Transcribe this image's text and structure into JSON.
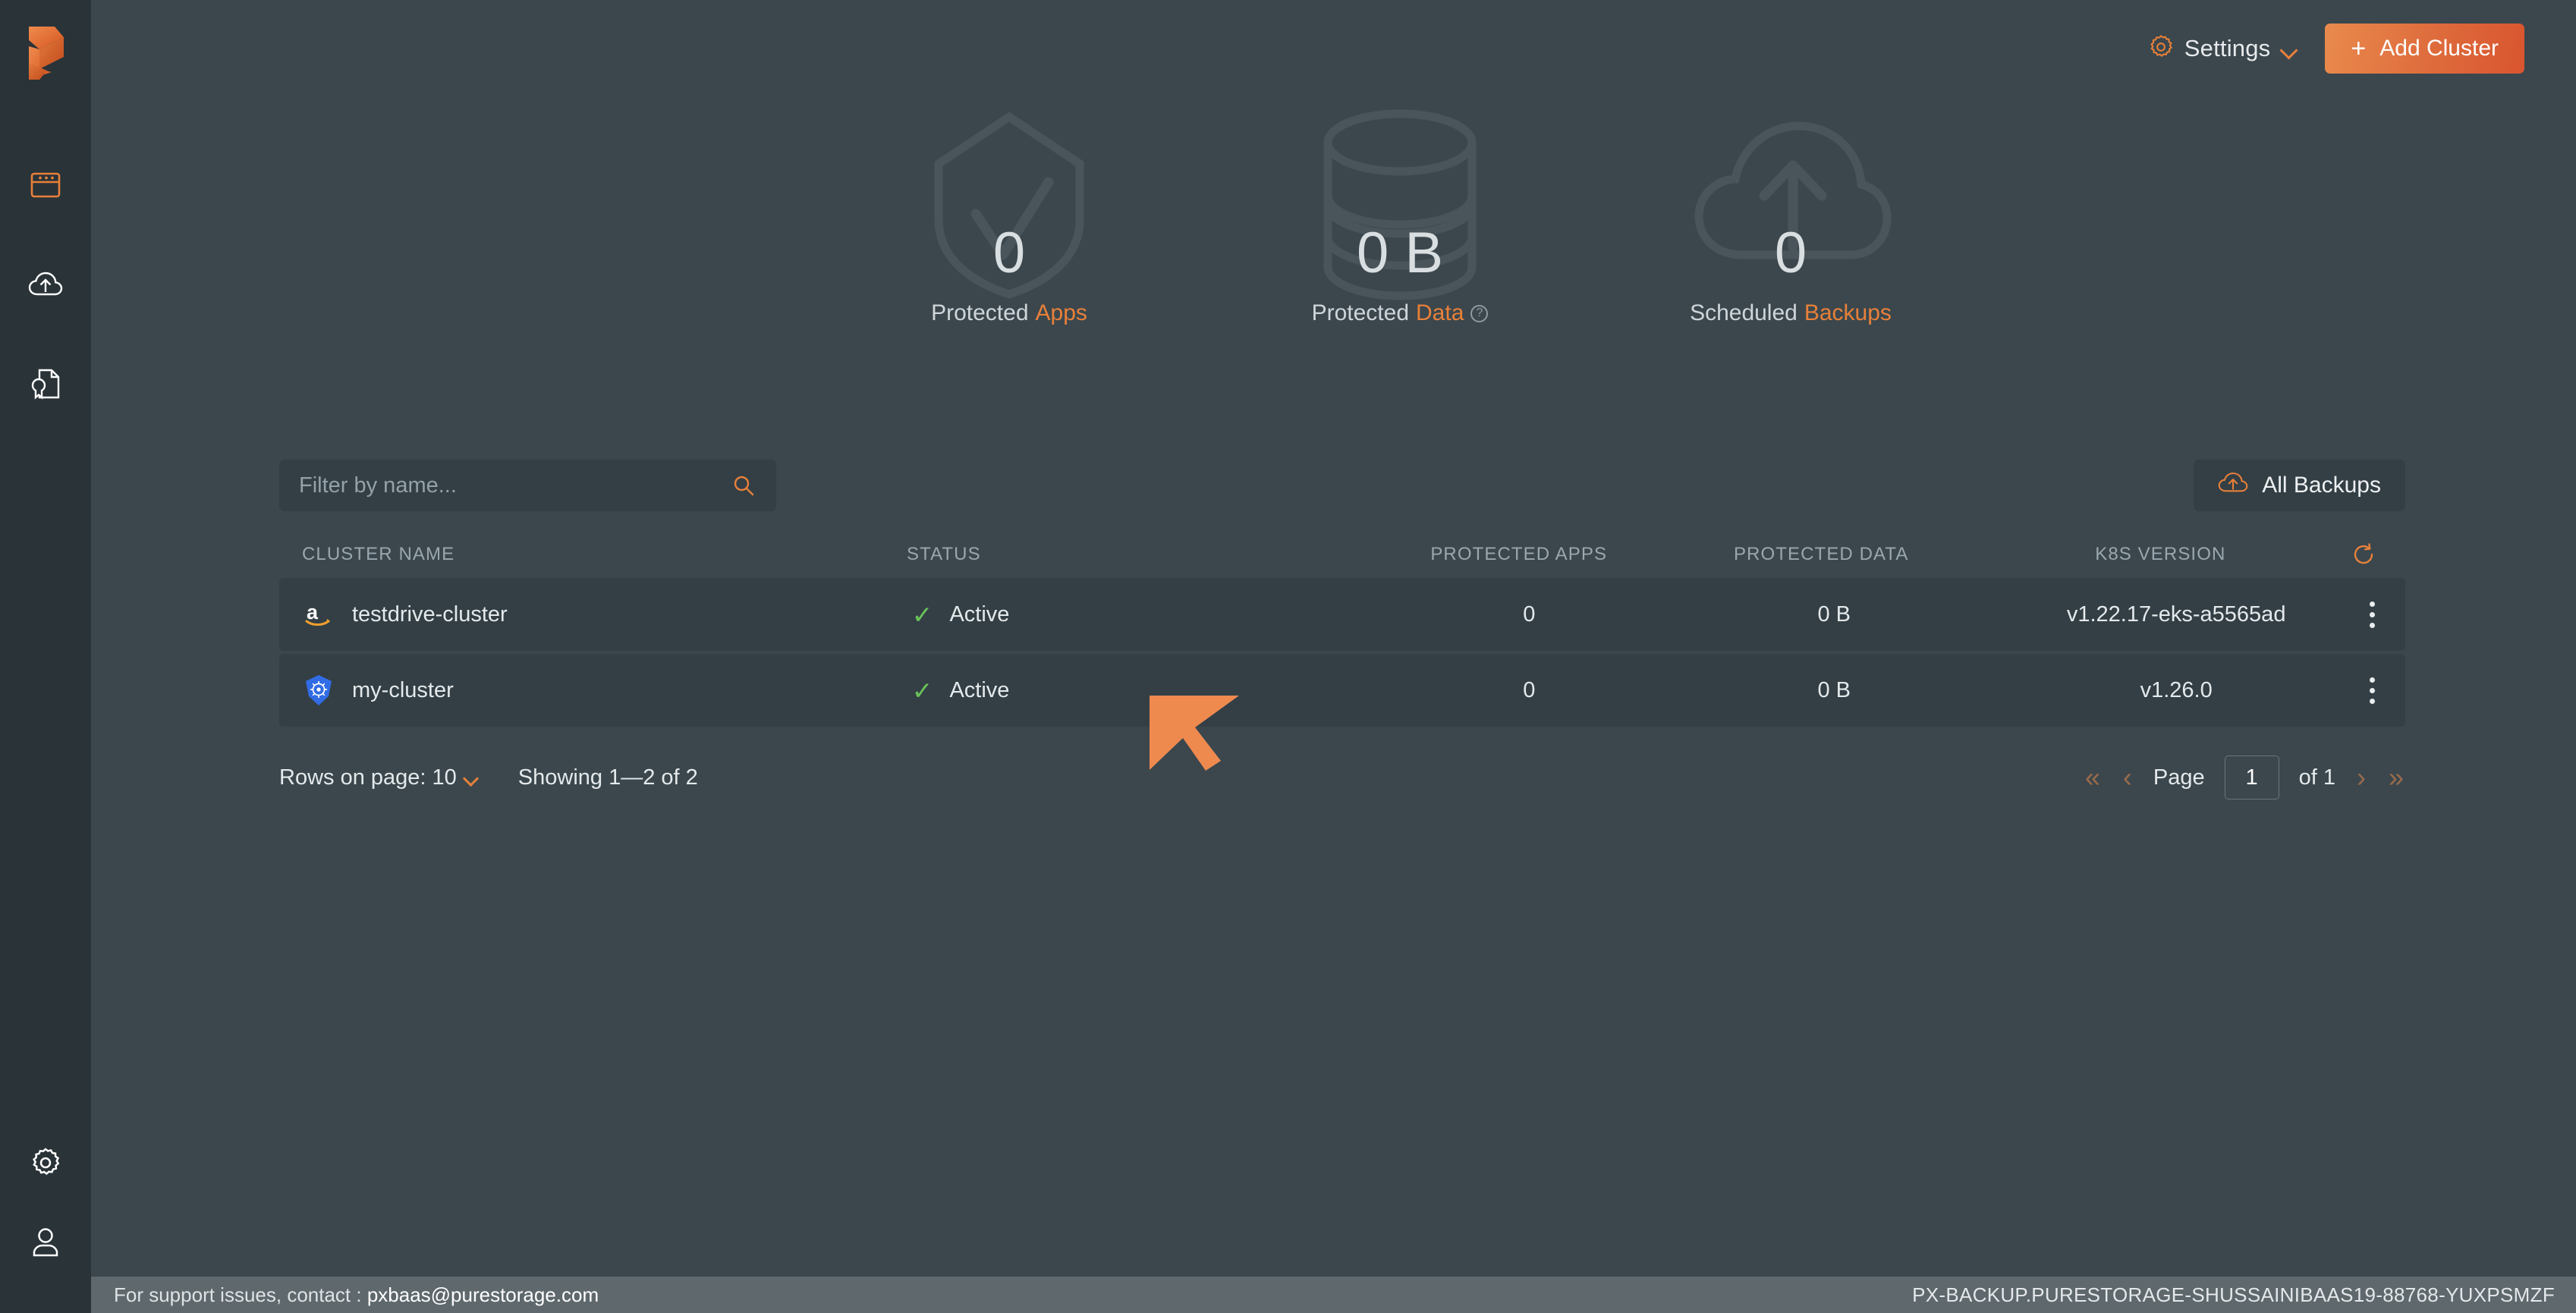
{
  "brand": {
    "accent": "#e8803a",
    "logo_icon": "portworx-logo-icon"
  },
  "sidebar": {
    "items": [
      {
        "name": "dashboard",
        "icon": "window-dashboard-icon",
        "active": true
      },
      {
        "name": "backups",
        "icon": "cloud-upload-icon",
        "active": false
      },
      {
        "name": "licenses",
        "icon": "document-badge-icon",
        "active": false
      }
    ],
    "bottom_items": [
      {
        "name": "settings",
        "icon": "gear-icon"
      },
      {
        "name": "account",
        "icon": "user-icon"
      }
    ]
  },
  "header": {
    "settings_label": "Settings",
    "settings_icon": "gear-icon",
    "settings_chevron": "chevron-down-icon",
    "add_cluster_label": "Add Cluster",
    "add_cluster_plus": "+"
  },
  "stats": [
    {
      "value": "0",
      "label_prefix": "Protected",
      "label_accent": "Apps",
      "icon": "shield-check-icon",
      "has_help": false
    },
    {
      "value": "0 B",
      "label_prefix": "Protected",
      "label_accent": "Data",
      "icon": "database-stack-icon",
      "has_help": true,
      "help_glyph": "?"
    },
    {
      "value": "0",
      "label_prefix": "Scheduled",
      "label_accent": "Backups",
      "icon": "cloud-upload-icon",
      "has_help": false
    }
  ],
  "toolbar": {
    "filter_placeholder": "Filter by name...",
    "filter_value": "",
    "search_icon": "search-icon",
    "all_backups_label": "All Backups",
    "all_backups_icon": "cloud-upload-icon"
  },
  "table": {
    "columns": [
      "CLUSTER NAME",
      "STATUS",
      "PROTECTED APPS",
      "PROTECTED DATA",
      "K8S VERSION"
    ],
    "refresh_icon": "refresh-icon",
    "rows": [
      {
        "icon": "aws-icon",
        "name": "testdrive-cluster",
        "status": "Active",
        "status_icon": "check-icon",
        "protected_apps": "0",
        "protected_data": "0 B",
        "k8s_version": "v1.22.17-eks-a5565ad",
        "actions_icon": "kebab-menu-icon"
      },
      {
        "icon": "kubernetes-icon",
        "name": "my-cluster",
        "status": "Active",
        "status_icon": "check-icon",
        "protected_apps": "0",
        "protected_data": "0 B",
        "k8s_version": "v1.26.0",
        "actions_icon": "kebab-menu-icon"
      }
    ]
  },
  "pagination": {
    "rows_label": "Rows on page: 10",
    "rows_chevron": "chevron-down-icon",
    "showing": "Showing 1—2 of 2",
    "first_icon": "«",
    "prev_icon": "‹",
    "page_label": "Page",
    "page_value": "1",
    "of_label": "of 1",
    "next_icon": "›",
    "last_icon": "»"
  },
  "statusbar": {
    "support_prefix": "For support issues, contact : ",
    "support_email": "pxbaas@purestorage.com",
    "instance_id": "PX-BACKUP.PURESTORAGE-SHUSSAINIBAAS19-88768-YUXPSMZF"
  }
}
